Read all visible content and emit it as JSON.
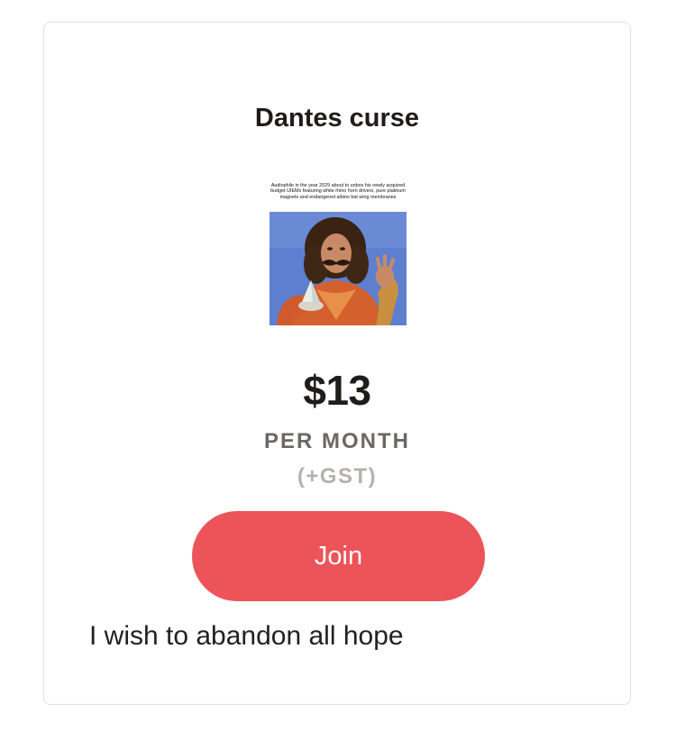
{
  "tier": {
    "title": "Dantes curse",
    "image_caption": "Audiophile in the year 2029 about to unbox his newly acquired budget UIEMs featuring white rhino horn drivers, pure platinum magnets and endangered albino bat wing membranes",
    "price": "$13",
    "period": "PER MONTH",
    "tax_note": "(+GST)",
    "join_label": "Join",
    "description": "I wish to abandon all hope"
  },
  "colors": {
    "accent": "#ec5459",
    "card_border": "#e2e0dc",
    "title_text": "#1f1d1a",
    "period_text": "#6b6864",
    "tax_text": "#b5b2ad"
  }
}
